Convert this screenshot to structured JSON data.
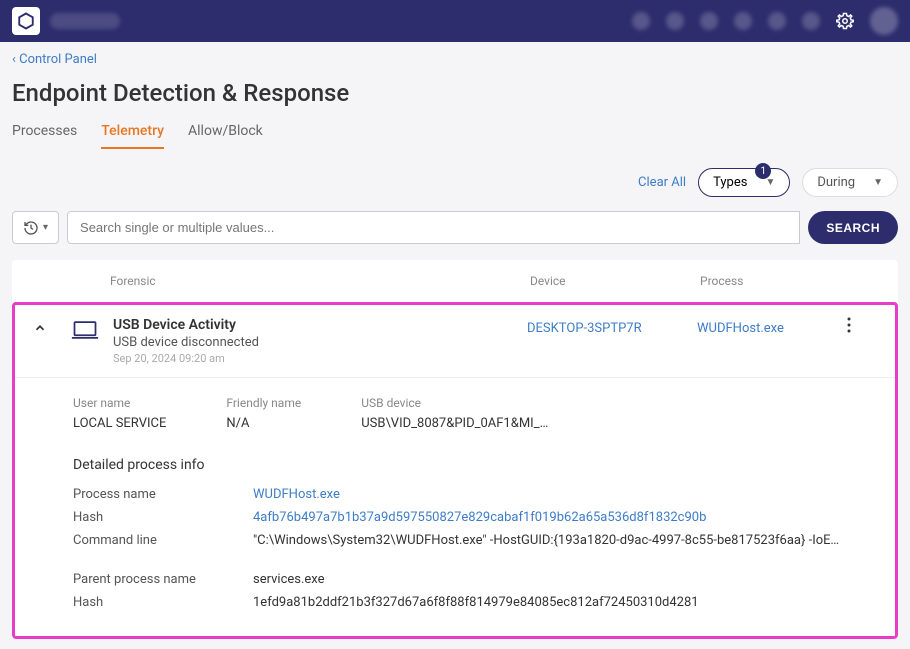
{
  "breadcrumb": "‹ Control Panel",
  "page_title": "Endpoint Detection & Response",
  "tabs": [
    {
      "label": "Processes",
      "active": false
    },
    {
      "label": "Telemetry",
      "active": true
    },
    {
      "label": "Allow/Block",
      "active": false
    }
  ],
  "filters": {
    "clear_all": "Clear All",
    "types_label": "Types",
    "types_badge": "1",
    "during_label": "During"
  },
  "search": {
    "placeholder": "Search single or multiple values...",
    "button": "SEARCH"
  },
  "table": {
    "headers": {
      "forensic": "Forensic",
      "device": "Device",
      "process": "Process"
    },
    "row": {
      "title": "USB Device Activity",
      "subtitle": "USB device disconnected",
      "timestamp": "Sep 20, 2024 09:20 am",
      "device": "DESKTOP-3SPTP7R",
      "process": "WUDFHost.exe"
    },
    "details": {
      "user_name_label": "User name",
      "user_name": "LOCAL SERVICE",
      "friendly_name_label": "Friendly name",
      "friendly_name": "N/A",
      "usb_device_label": "USB device",
      "usb_device": "USB\\VID_8087&PID_0AF1&MI_…",
      "section_title": "Detailed process info",
      "process_name_label": "Process name",
      "process_name": "WUDFHost.exe",
      "hash_label": "Hash",
      "hash": "4afb76b497a7b1b37a9d597550827e829cabaf1f019b62a65a536d8f1832c90b",
      "command_line_label": "Command line",
      "command_line": "\"C:\\Windows\\System32\\WUDFHost.exe\" -HostGUID:{193a1820-d9ac-4997-8c55-be817523f6aa} -IoEvent…",
      "parent_process_label": "Parent process name",
      "parent_process": "services.exe",
      "parent_hash_label": "Hash",
      "parent_hash": "1efd9a81b2ddf21b3f327d67a6f8f88f814979e84085ec812af72450310d4281"
    }
  }
}
